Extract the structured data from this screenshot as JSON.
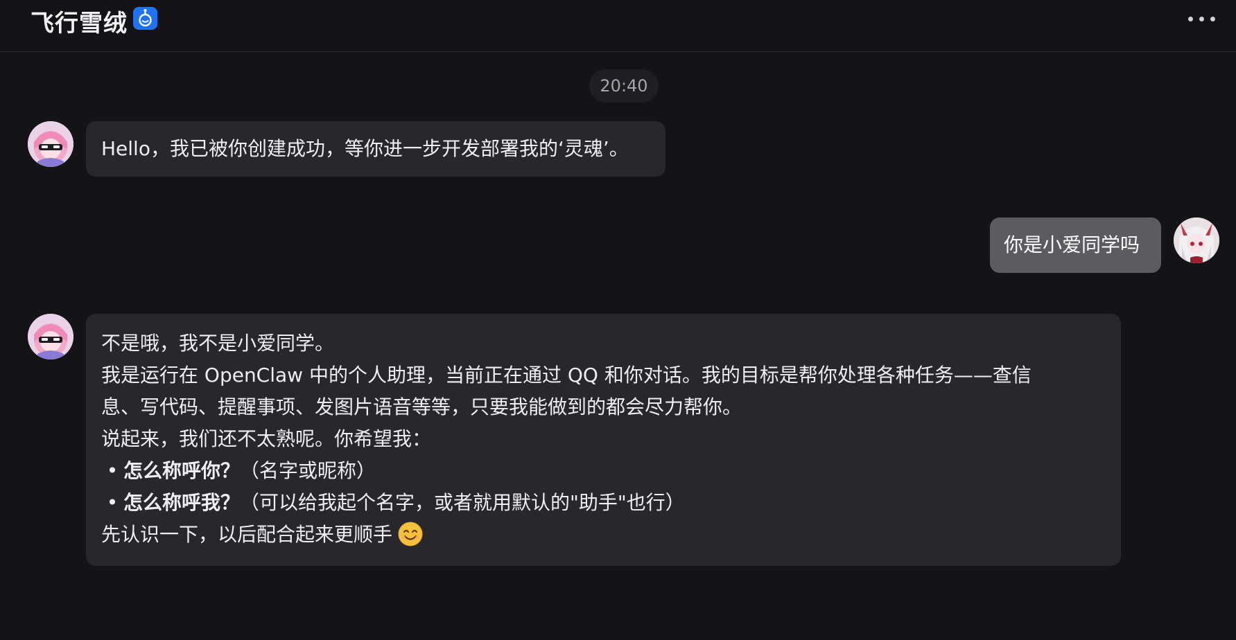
{
  "header": {
    "title": "飞行雪绒",
    "bot_icon": "robot-icon",
    "more_icon": "more-horizontal-icon"
  },
  "timestamp": "20:40",
  "messages": {
    "bot_greeting": "Hello，我已被你创建成功，等你进一步开发部署我的‘灵魂’。",
    "user_question": "你是小爱同学吗",
    "bot_reply": {
      "line1": "不是哦，我不是小爱同学。",
      "line2": "我是运行在 OpenClaw 中的个人助理，当前正在通过 QQ 和你对话。我的目标是帮你处理各种任务——查信",
      "line3": "息、写代码、提醒事项、发图片语音等等，只要我能做到的都会尽力帮你。",
      "line4": "说起来，我们还不太熟呢。你希望我：",
      "bullets": [
        {
          "marker": "•",
          "bold": "怎么称呼你？",
          "rest": "（名字或昵称）"
        },
        {
          "marker": "•",
          "bold": "怎么称呼我？",
          "rest": "（可以给我起个名字，或者就用默认的\"助手\"也行）"
        }
      ],
      "line_last": "先认识一下，以后配合起来更顺手",
      "emoji": "smiling-face-emoji"
    }
  },
  "colors": {
    "background": "#141316",
    "bot_bubble": "#28272c",
    "user_bubble": "#5b5b60",
    "badge": "#1f72f2"
  }
}
